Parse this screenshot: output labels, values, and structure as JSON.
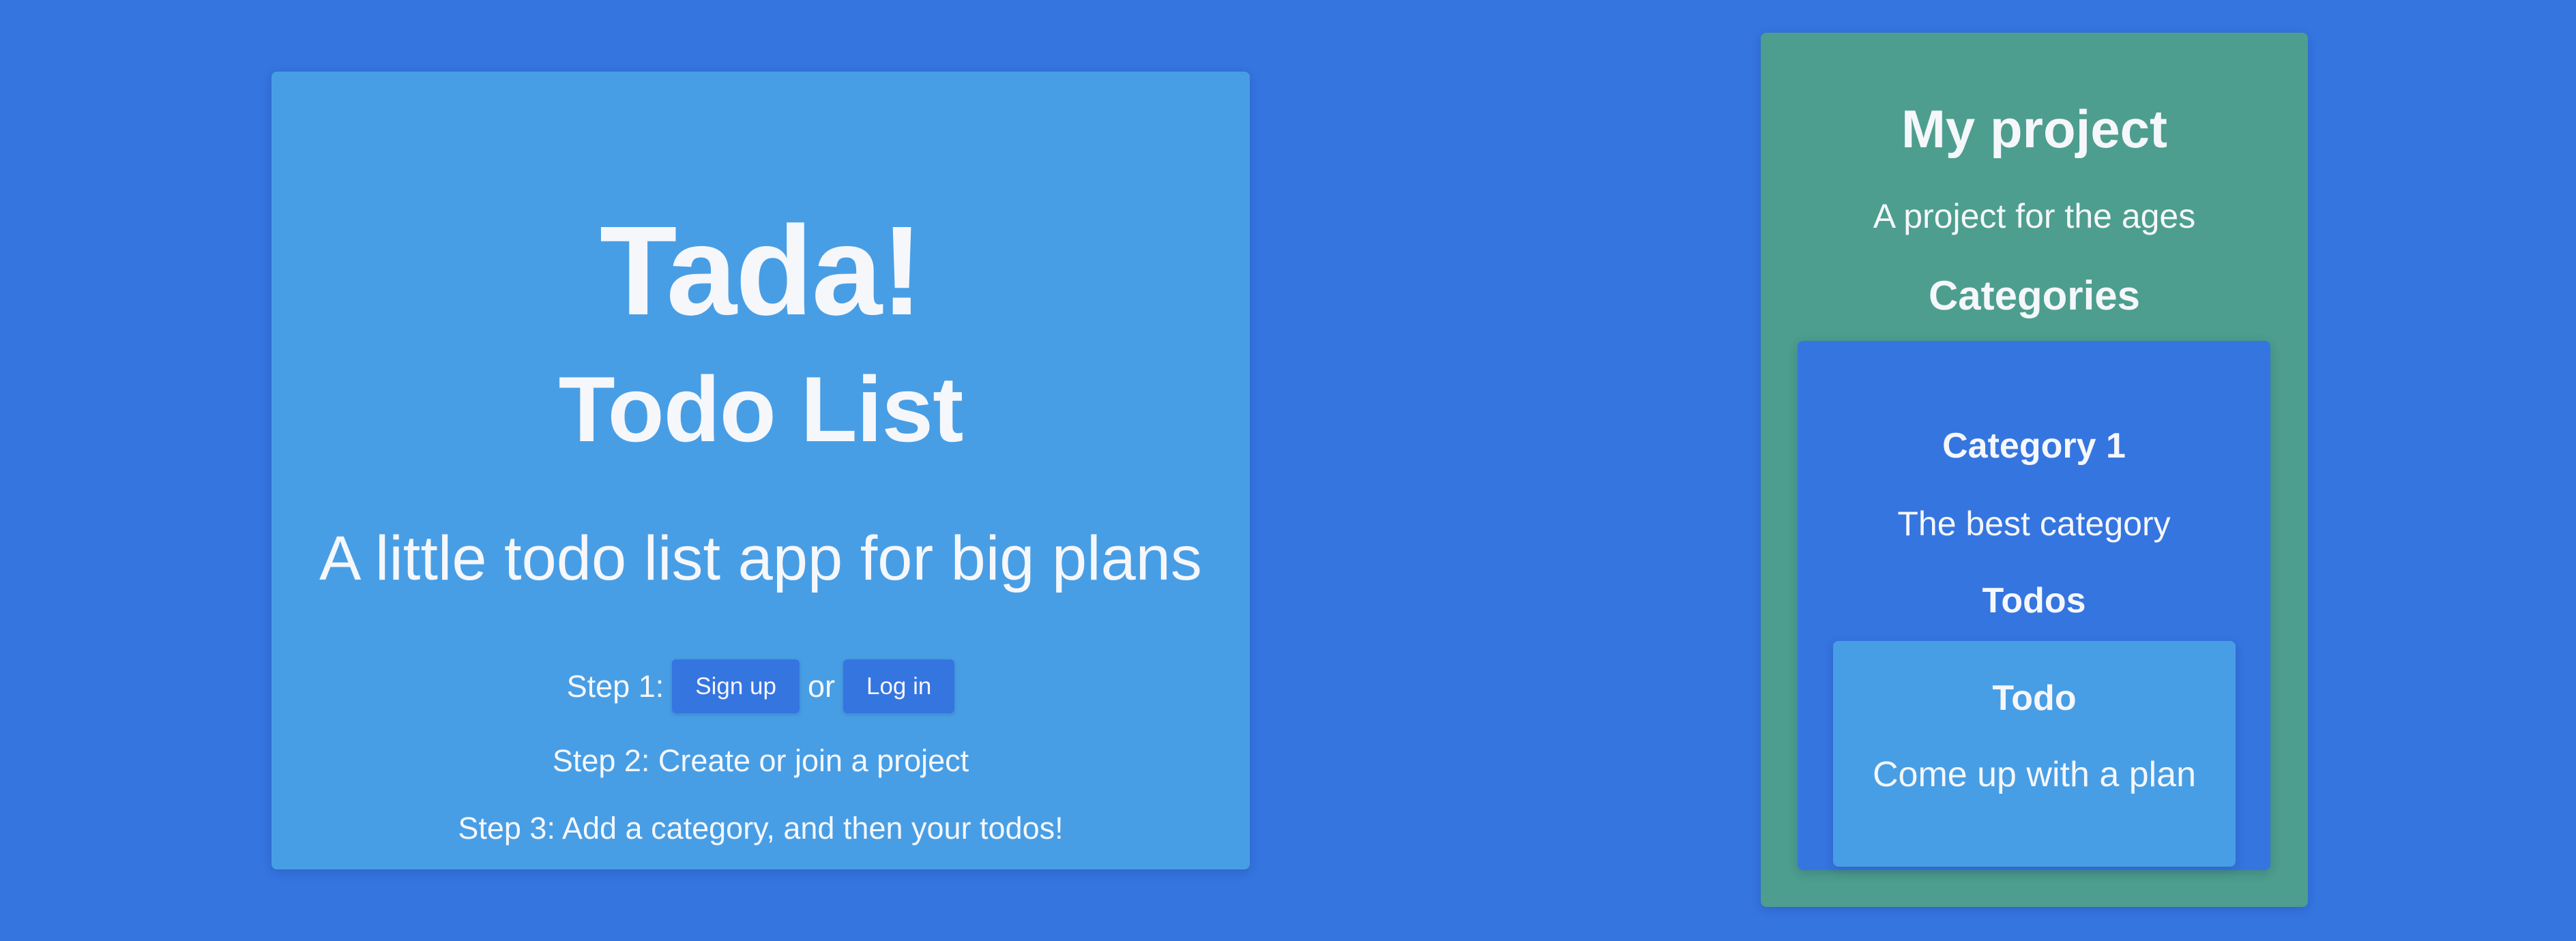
{
  "hero": {
    "title": "Tada!",
    "subtitle": "Todo List",
    "tagline": "A little todo list app for big plans",
    "step1_prefix": "Step 1:",
    "signup_label": "Sign up",
    "or_text": "or",
    "login_label": "Log in",
    "step2": "Step 2: Create or join a project",
    "step3": "Step 3: Add a category, and then your todos!"
  },
  "project": {
    "title": "My project",
    "description": "A project for the ages",
    "categories_heading": "Categories",
    "category": {
      "title": "Category 1",
      "description": "The best category",
      "todos_heading": "Todos",
      "todo": {
        "title": "Todo",
        "description": "Come up with a plan"
      }
    }
  },
  "colors": {
    "background": "#3575E0",
    "card_light_blue": "#489EE5",
    "card_teal": "#4D9E8E",
    "text": "#F5F7FB"
  }
}
